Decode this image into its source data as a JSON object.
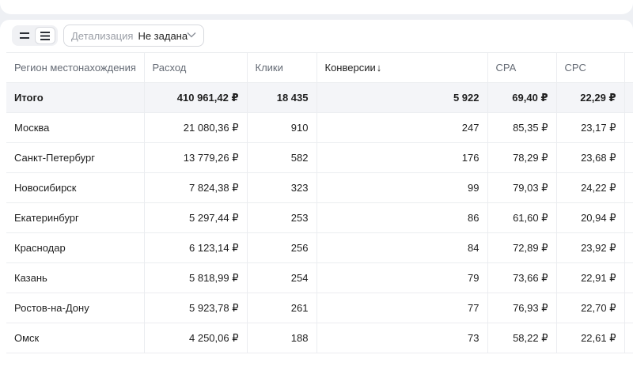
{
  "toolbar": {
    "detail_label": "Детализация",
    "detail_value": "Не задана"
  },
  "table": {
    "columns": [
      {
        "label": "Регион местонахождения"
      },
      {
        "label": "Расход"
      },
      {
        "label": "Клики"
      },
      {
        "label": "Конверсии",
        "sort": "↓"
      },
      {
        "label": "CPA"
      },
      {
        "label": "CPC"
      }
    ],
    "total": {
      "region": "Итого",
      "spend": "410 961,42 ₽",
      "clicks": "18 435",
      "conversions": "5 922",
      "cpa": "69,40 ₽",
      "cpc": "22,29 ₽"
    },
    "rows": [
      {
        "region": "Москва",
        "spend": "21 080,36 ₽",
        "clicks": "910",
        "conversions": "247",
        "cpa": "85,35 ₽",
        "cpc": "23,17 ₽"
      },
      {
        "region": "Санкт-Петербург",
        "spend": "13 779,26 ₽",
        "clicks": "582",
        "conversions": "176",
        "cpa": "78,29 ₽",
        "cpc": "23,68 ₽"
      },
      {
        "region": "Новосибирск",
        "spend": "7 824,38 ₽",
        "clicks": "323",
        "conversions": "99",
        "cpa": "79,03 ₽",
        "cpc": "24,22 ₽"
      },
      {
        "region": "Екатеринбург",
        "spend": "5 297,44 ₽",
        "clicks": "253",
        "conversions": "86",
        "cpa": "61,60 ₽",
        "cpc": "20,94 ₽"
      },
      {
        "region": "Краснодар",
        "spend": "6 123,14 ₽",
        "clicks": "256",
        "conversions": "84",
        "cpa": "72,89 ₽",
        "cpc": "23,92 ₽"
      },
      {
        "region": "Казань",
        "spend": "5 818,99 ₽",
        "clicks": "254",
        "conversions": "79",
        "cpa": "73,66 ₽",
        "cpc": "22,91 ₽"
      },
      {
        "region": "Ростов-на-Дону",
        "spend": "5 923,78 ₽",
        "clicks": "261",
        "conversions": "77",
        "cpa": "76,93 ₽",
        "cpc": "22,70 ₽"
      },
      {
        "region": "Омск",
        "spend": "4 250,06 ₽",
        "clicks": "188",
        "conversions": "73",
        "cpa": "58,22 ₽",
        "cpc": "22,61 ₽"
      }
    ]
  },
  "icons": {
    "compact_view": "compact-rows-icon",
    "comfortable_view": "comfortable-rows-icon",
    "chevron": "chevron-down-icon"
  }
}
